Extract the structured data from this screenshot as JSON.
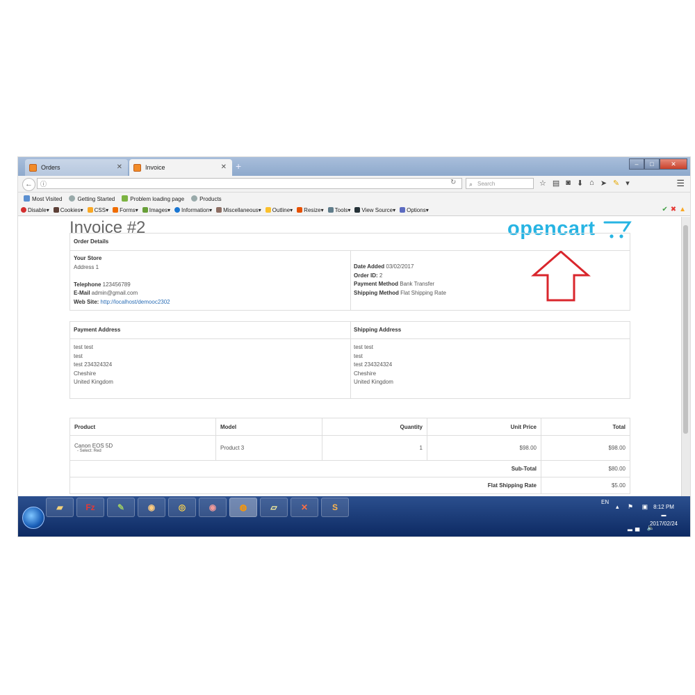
{
  "browser": {
    "tabs": [
      {
        "label": "Orders",
        "active": false
      },
      {
        "label": "Invoice",
        "active": true
      }
    ],
    "url": "",
    "search_placeholder": "Search",
    "bookmarks": [
      "Most Visited",
      "Getting Started",
      "Problem loading page",
      "Products"
    ],
    "devbar": [
      "Disable",
      "Cookies",
      "CSS",
      "Forms",
      "Images",
      "Information",
      "Miscellaneous",
      "Outline",
      "Resize",
      "Tools",
      "View Source",
      "Options"
    ]
  },
  "invoice": {
    "title": "Invoice #2",
    "logo_text": "opencart",
    "order_details": {
      "heading": "Order Details",
      "store_name": "Your Store",
      "address": "Address 1",
      "telephone_label": "Telephone",
      "telephone": "123456789",
      "email_label": "E-Mail",
      "email": "admin@gmail.com",
      "website_label": "Web Site:",
      "website": "http://localhost/demooc2302",
      "date_added_label": "Date Added",
      "date_added": "03/02/2017",
      "order_id_label": "Order ID:",
      "order_id": "2",
      "payment_method_label": "Payment Method",
      "payment_method": "Bank Transfer",
      "shipping_method_label": "Shipping Method",
      "shipping_method": "Flat Shipping Rate"
    },
    "payment_address": {
      "heading": "Payment Address",
      "lines": [
        "test test",
        "test",
        "test 234324324",
        "Cheshire",
        "United Kingdom"
      ]
    },
    "shipping_address": {
      "heading": "Shipping Address",
      "lines": [
        "test test",
        "test",
        "test 234324324",
        "Cheshire",
        "United Kingdom"
      ]
    },
    "products": {
      "headers": {
        "product": "Product",
        "model": "Model",
        "quantity": "Quantity",
        "unit_price": "Unit Price",
        "total": "Total"
      },
      "rows": [
        {
          "name": "Canon EOS 5D",
          "option": "- Select: Red",
          "model": "Product 3",
          "quantity": "1",
          "unit_price": "$98.00",
          "total": "$98.00"
        }
      ],
      "totals": [
        {
          "label": "Sub-Total",
          "value": "$80.00"
        },
        {
          "label": "Flat Shipping Rate",
          "value": "$5.00"
        }
      ]
    }
  },
  "taskbar": {
    "language": "EN",
    "time": "8:12 PM",
    "date": "2017/02/24"
  },
  "colors": {
    "logo": "#27b4e3",
    "arrow": "#d9262c",
    "taskbar": "#0d2a63"
  }
}
